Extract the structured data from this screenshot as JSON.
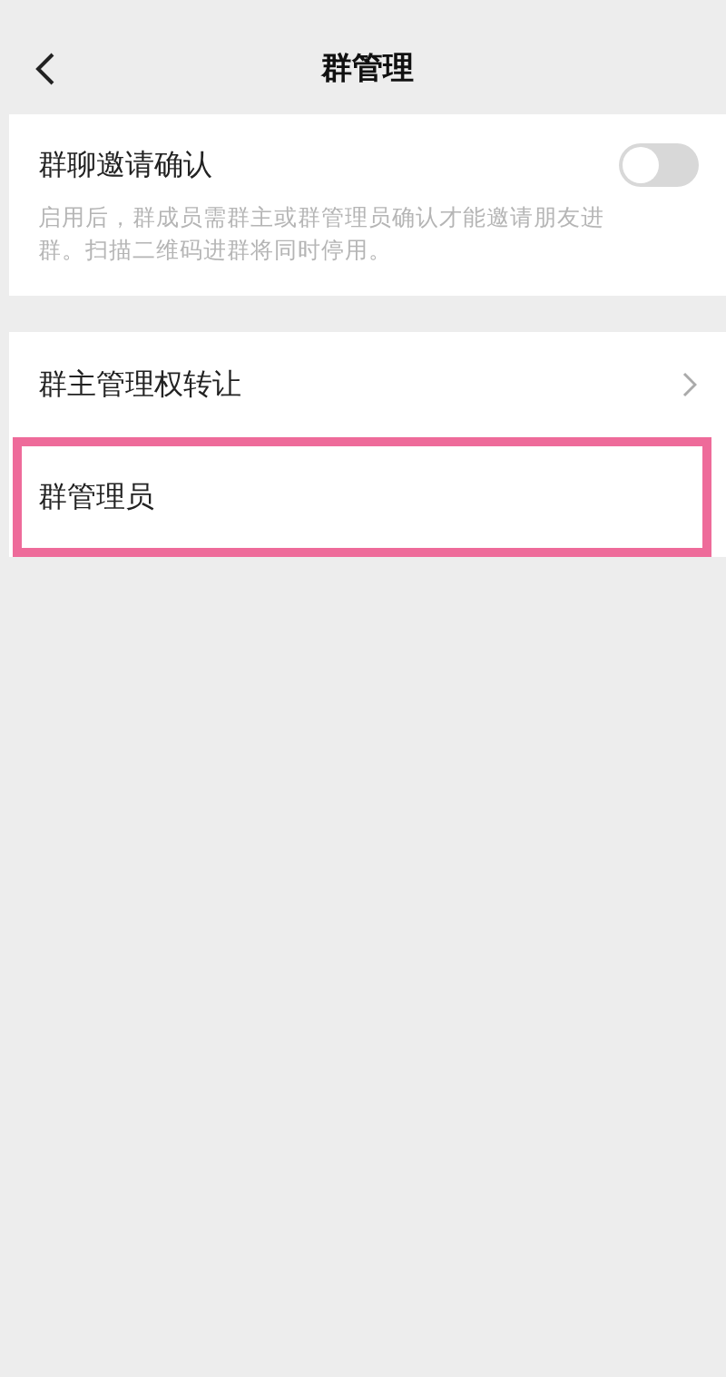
{
  "header": {
    "title": "群管理"
  },
  "invite_confirm": {
    "label": "群聊邀请确认",
    "on": false,
    "description": "启用后，群成员需群主或群管理员确认才能邀请朋友进群。扫描二维码进群将同时停用。"
  },
  "items": [
    {
      "label": "群主管理权转让",
      "kind": "link",
      "highlighted": false
    },
    {
      "label": "群管理员",
      "kind": "plain",
      "highlighted": true
    }
  ]
}
